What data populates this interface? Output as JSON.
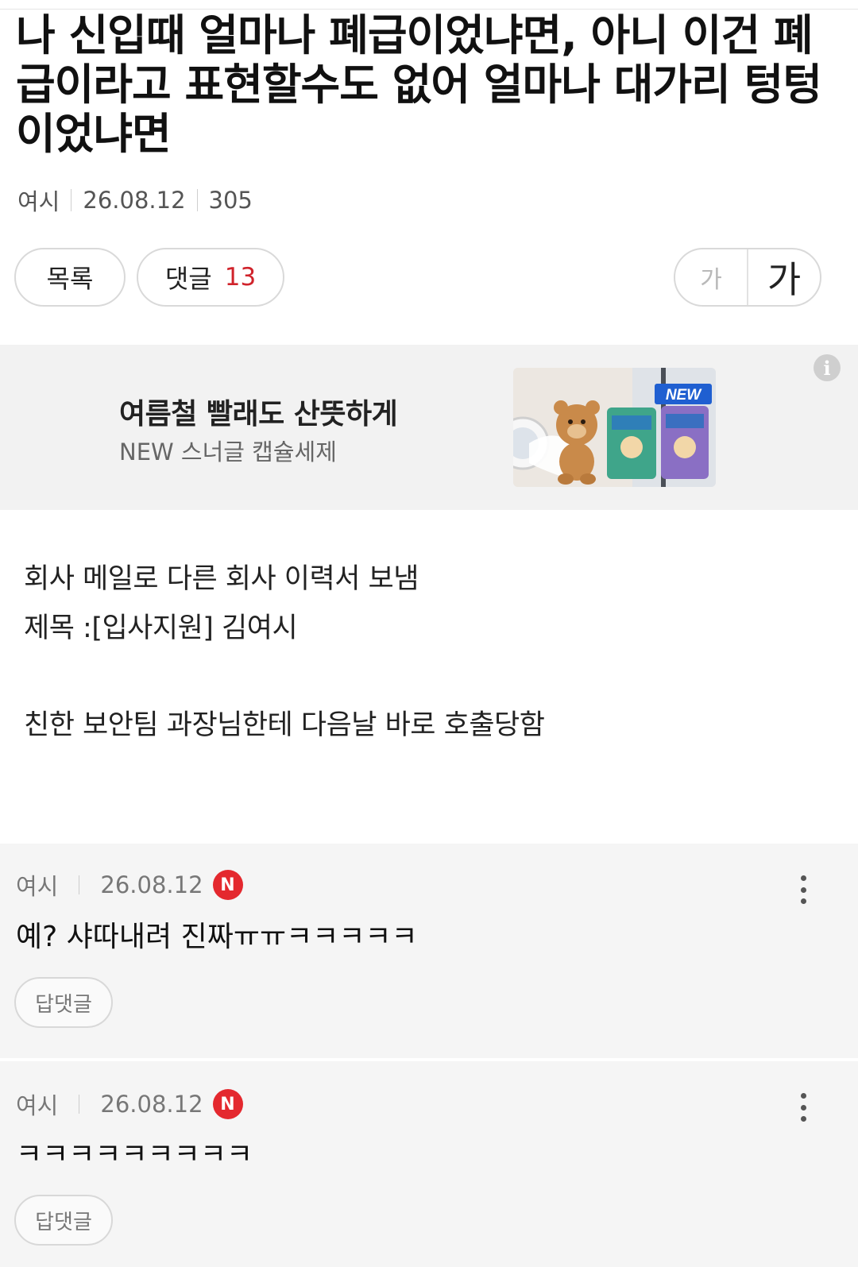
{
  "post": {
    "title": "나 신입때 얼마나 폐급이었냐면, 아니 이건 폐급이라고 표현할수도 없어 얼마나 대가리 텅텅이었냐면",
    "author": "여시",
    "date": "26.08.12",
    "views": "305"
  },
  "actions": {
    "list_label": "목록",
    "comment_label": "댓글",
    "comment_count": "13",
    "font_small": "가",
    "font_large": "가"
  },
  "ad": {
    "title": "여름철 빨래도 산뜻하게",
    "subtitle": "NEW 스너글 캡슐세제",
    "badge": "NEW",
    "info_icon": "info-icon"
  },
  "content": {
    "line1": "회사 메일로 다른 회사 이력서 보냄",
    "line2": "제목 :[입사지원] 김여시",
    "line3": "친한 보안팀 과장님한테 다음날 바로 호출당함"
  },
  "comments": [
    {
      "author": "여시",
      "date": "26.08.12",
      "badge": "N",
      "text": "예? 샤따내려 진짜ㅠㅠㅋㅋㅋㅋㅋ",
      "reply_label": "답댓글"
    },
    {
      "author": "여시",
      "date": "26.08.12",
      "badge": "N",
      "text": "ㅋㅋㅋㅋㅋㅋㅋㅋㅋ",
      "reply_label": "답댓글"
    }
  ],
  "colors": {
    "accent_red": "#d0232b",
    "new_badge": "#e4282e",
    "ad_background": "#f2f2f2",
    "comment_background": "#f5f5f5"
  }
}
